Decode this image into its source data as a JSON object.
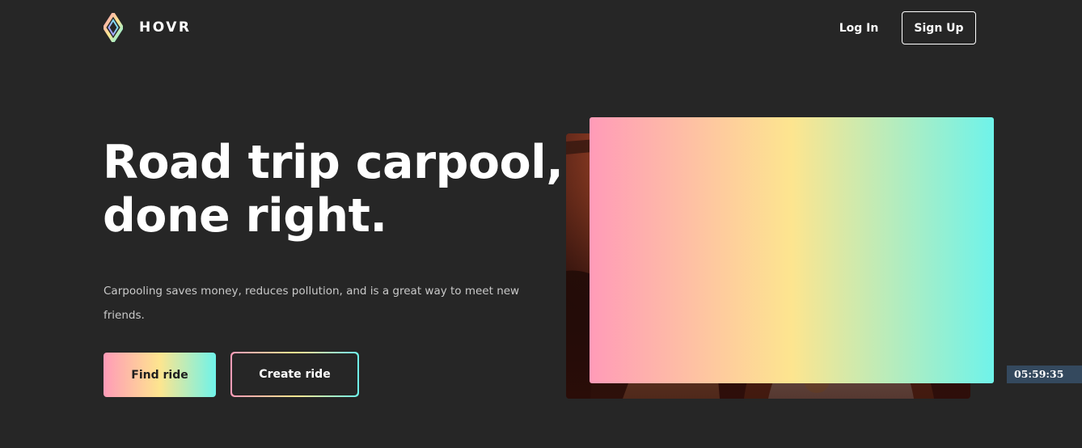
{
  "header": {
    "brand": "HOVR",
    "logo_icon": "hovr-diamond-logo-icon",
    "login_label": "Log In",
    "signup_label": "Sign Up"
  },
  "hero": {
    "title_line1": "Road trip carpool,",
    "title_line2": "done right.",
    "subtitle": "Carpooling saves money, reduces pollution, and is a great way to meet new friends.",
    "find_ride_label": "Find ride",
    "create_ride_label": "Create ride",
    "photo_icon": "hero-photo-image"
  },
  "timer": {
    "value": "05:59:35"
  },
  "colors": {
    "background": "#262626",
    "gradient_pink": "#ff9bb8",
    "gradient_yellow": "#fde58f",
    "gradient_cyan": "#6ff3ea",
    "timer_bg": "#34495e"
  }
}
